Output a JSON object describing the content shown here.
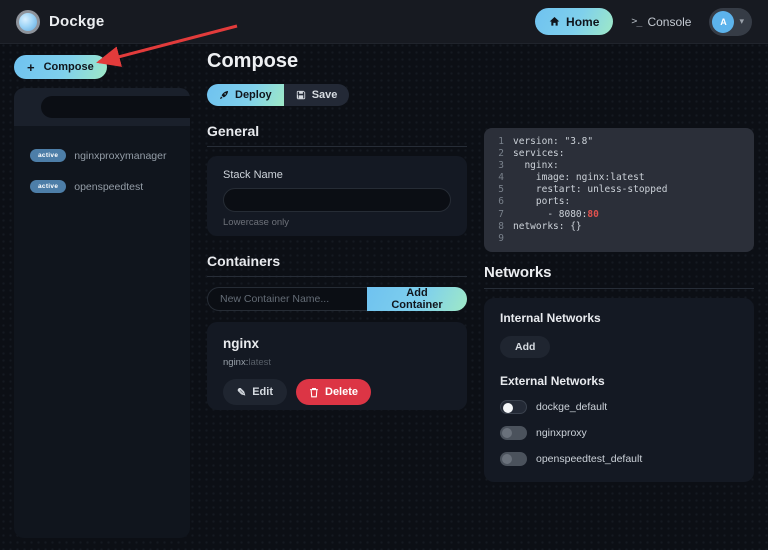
{
  "colors": {
    "accent_gradient_start": "#6fc2f0",
    "accent_gradient_end": "#9fe9c6",
    "danger_red": "#dc3545",
    "badge_blue": "#4d7ea8",
    "arrow_red": "#e23b3b",
    "code_highlight_red": "#e0524e"
  },
  "navbar": {
    "app_name": "Dockge",
    "home_label": "Home",
    "console_glyph": ">_",
    "console_label": "Console",
    "avatar_letter": "A",
    "caret_glyph": "▾"
  },
  "sidebar": {
    "compose_button": {
      "plus": "+",
      "label": "Compose"
    },
    "search_value": "",
    "stacks": [
      {
        "status": "active",
        "name": "nginxproxymanager"
      },
      {
        "status": "active",
        "name": "openspeedtest"
      }
    ]
  },
  "main": {
    "title": "Compose",
    "toolbar": {
      "deploy_label": "Deploy",
      "save_label": "Save"
    },
    "general": {
      "heading": "General",
      "stack_name_label": "Stack Name",
      "stack_name_value": "",
      "hint": "Lowercase only"
    },
    "containers": {
      "heading": "Containers",
      "new_container_placeholder": "New Container Name...",
      "add_button_label": "Add Container",
      "items": [
        {
          "name": "nginx",
          "image_label": "nginx:",
          "image_tag": "latest",
          "edit_glyph": "✎",
          "edit_label": "Edit",
          "delete_label": "Delete"
        }
      ]
    }
  },
  "editor": {
    "lines": [
      {
        "num": "1",
        "text": "version: \"3.8\""
      },
      {
        "num": "2",
        "text": "services:"
      },
      {
        "num": "3",
        "text": "  nginx:"
      },
      {
        "num": "4",
        "text": "    image: nginx:latest"
      },
      {
        "num": "5",
        "text": "    restart: unless-stopped"
      },
      {
        "num": "6",
        "text": "    ports:"
      },
      {
        "num": "7",
        "text": "      - 8080:",
        "hl": "80"
      },
      {
        "num": "8",
        "text": "networks: {}"
      },
      {
        "num": "9",
        "text": ""
      }
    ]
  },
  "networks": {
    "heading": "Networks",
    "internal_heading": "Internal Networks",
    "add_button_label": "Add",
    "external_heading": "External Networks",
    "external": [
      {
        "name": "dockge_default",
        "enabled": false
      },
      {
        "name": "nginxproxy",
        "enabled": false
      },
      {
        "name": "openspeedtest_default",
        "enabled": false
      }
    ]
  }
}
